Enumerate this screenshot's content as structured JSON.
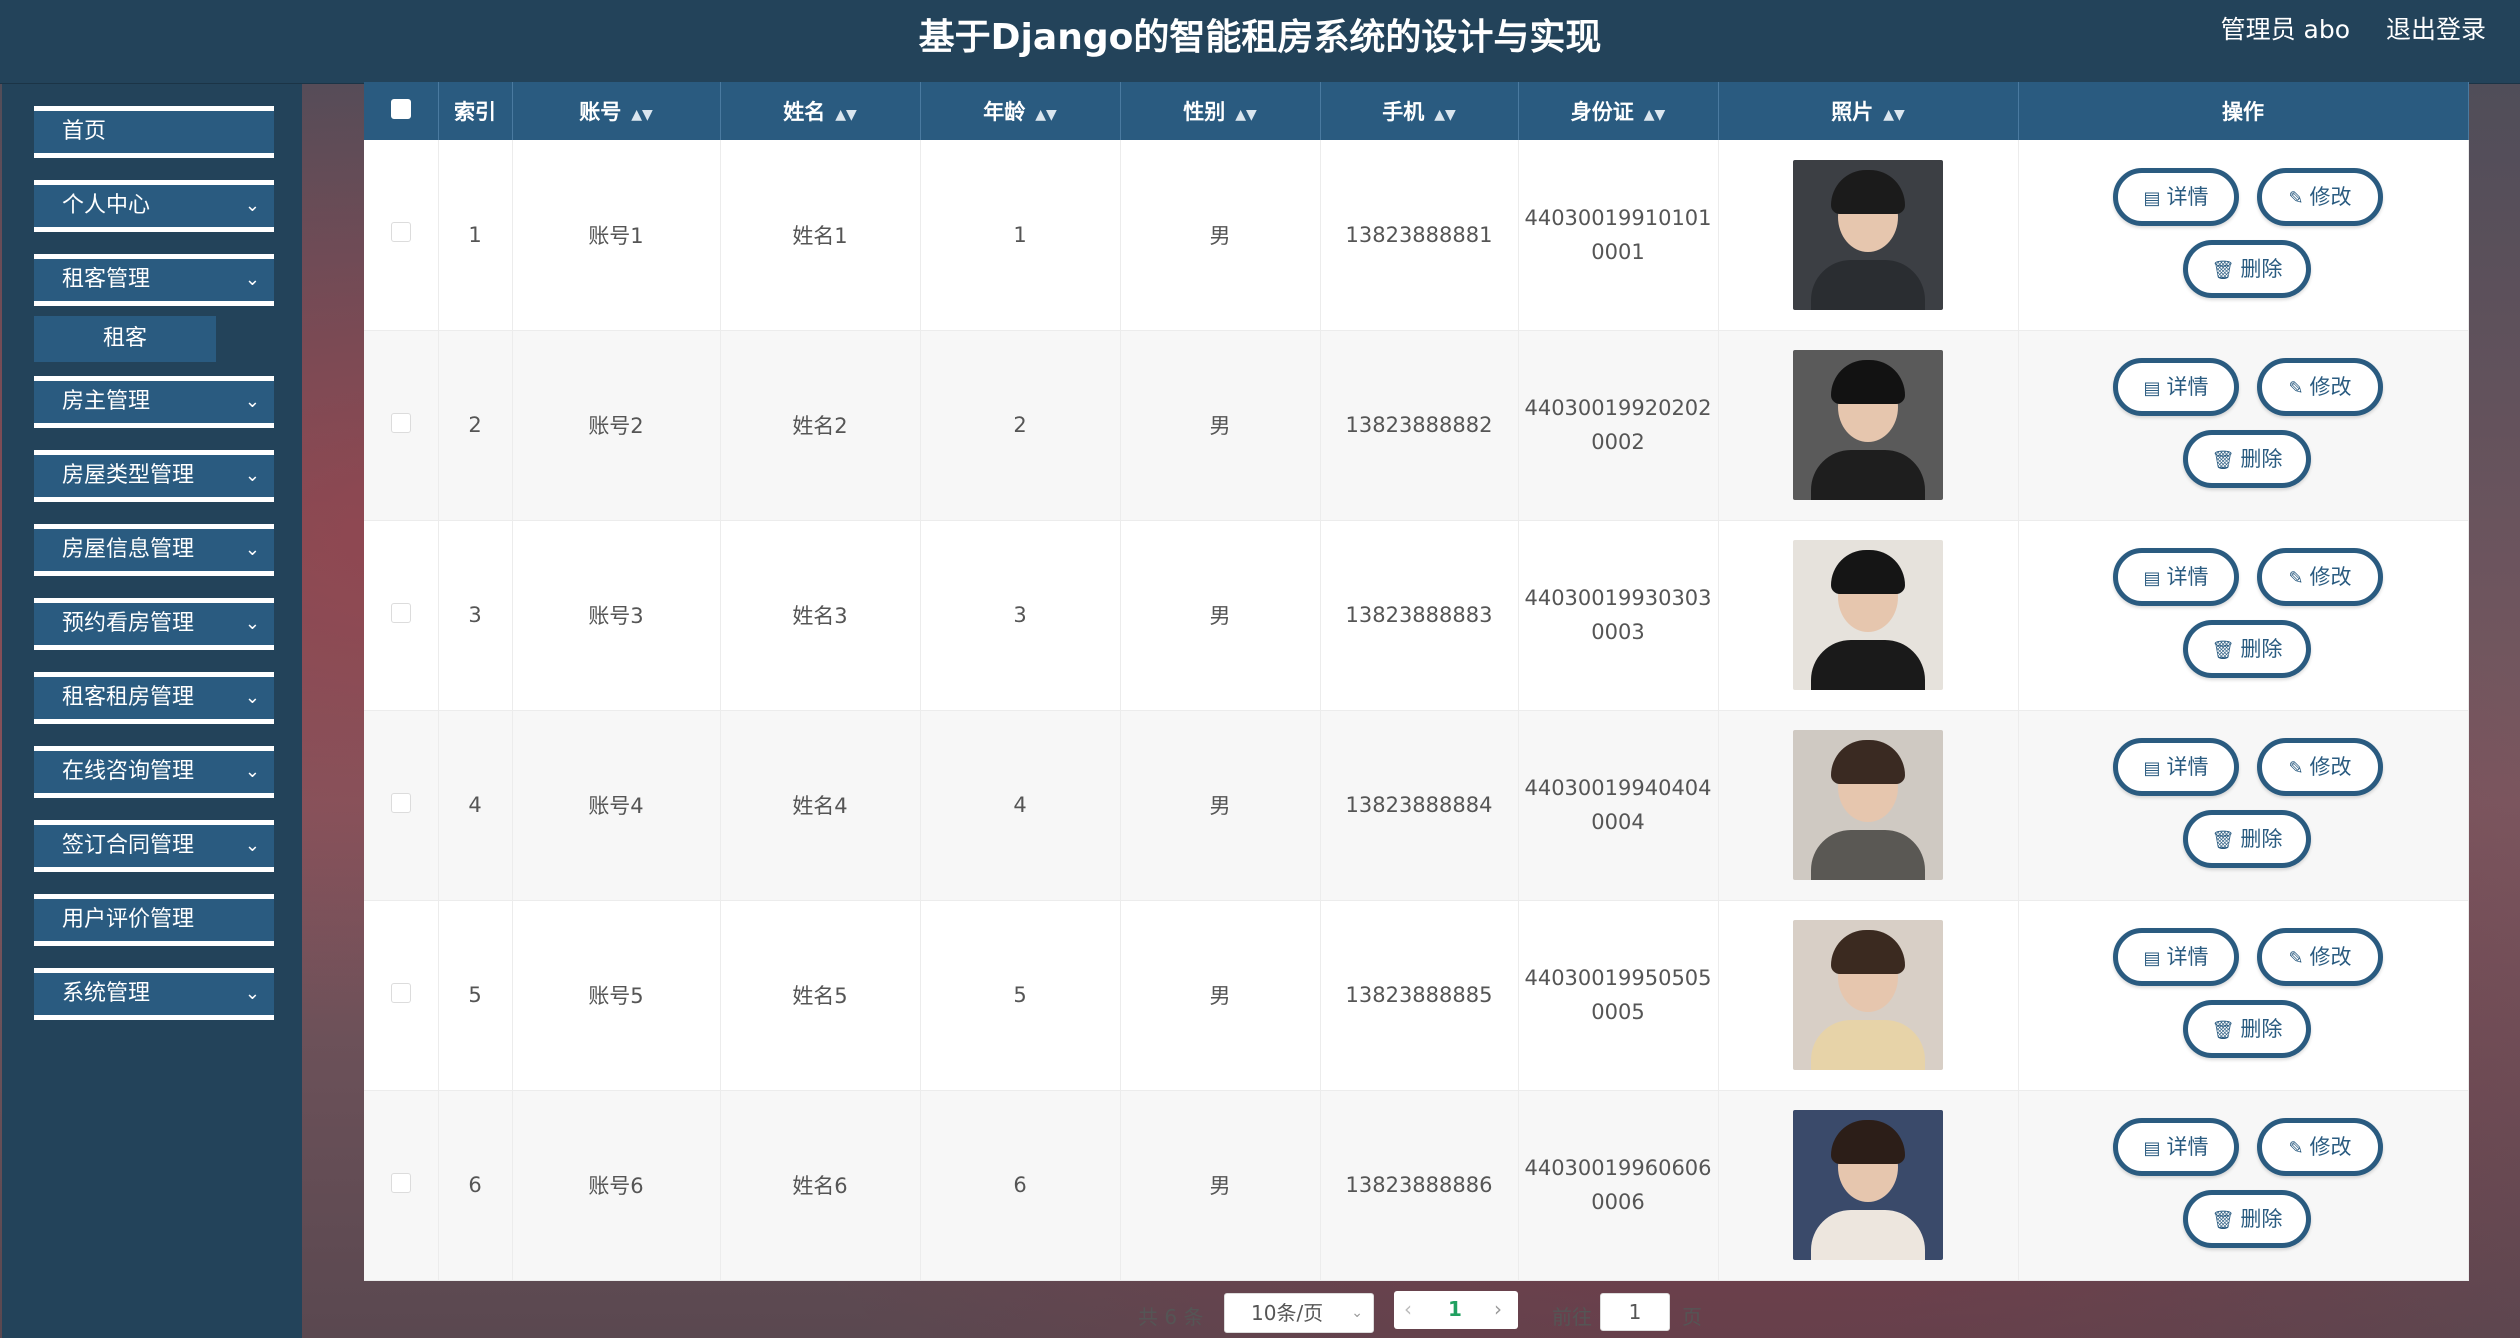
{
  "header": {
    "title": "基于Django的智能租房系统的设计与实现",
    "admin": "管理员 abo",
    "logout": "退出登录"
  },
  "sidebar": {
    "items": [
      {
        "label": "首页",
        "has_arrow": false
      },
      {
        "label": "个人中心",
        "has_arrow": true
      },
      {
        "label": "租客管理",
        "has_arrow": true
      },
      {
        "label": "房主管理",
        "has_arrow": true
      },
      {
        "label": "房屋类型管理",
        "has_arrow": true
      },
      {
        "label": "房屋信息管理",
        "has_arrow": true
      },
      {
        "label": "预约看房管理",
        "has_arrow": true
      },
      {
        "label": "租客租房管理",
        "has_arrow": true
      },
      {
        "label": "在线咨询管理",
        "has_arrow": true
      },
      {
        "label": "签订合同管理",
        "has_arrow": true
      },
      {
        "label": "用户评价管理",
        "has_arrow": false
      },
      {
        "label": "系统管理",
        "has_arrow": true
      }
    ],
    "sub_item": "租客"
  },
  "table": {
    "columns": [
      "索引",
      "账号",
      "姓名",
      "年龄",
      "性别",
      "手机",
      "身份证",
      "照片",
      "操作"
    ],
    "rows": [
      {
        "index": "1",
        "account": "账号1",
        "name": "姓名1",
        "age": "1",
        "gender": "男",
        "phone": "13823888881",
        "id_line1": "44030019910101",
        "id_line2": "0001"
      },
      {
        "index": "2",
        "account": "账号2",
        "name": "姓名2",
        "age": "2",
        "gender": "男",
        "phone": "13823888882",
        "id_line1": "44030019920202",
        "id_line2": "0002"
      },
      {
        "index": "3",
        "account": "账号3",
        "name": "姓名3",
        "age": "3",
        "gender": "男",
        "phone": "13823888883",
        "id_line1": "44030019930303",
        "id_line2": "0003"
      },
      {
        "index": "4",
        "account": "账号4",
        "name": "姓名4",
        "age": "4",
        "gender": "男",
        "phone": "13823888884",
        "id_line1": "44030019940404",
        "id_line2": "0004"
      },
      {
        "index": "5",
        "account": "账号5",
        "name": "姓名5",
        "age": "5",
        "gender": "男",
        "phone": "13823888885",
        "id_line1": "44030019950505",
        "id_line2": "0005"
      },
      {
        "index": "6",
        "account": "账号6",
        "name": "姓名6",
        "age": "6",
        "gender": "男",
        "phone": "13823888886",
        "id_line1": "44030019960606",
        "id_line2": "0006"
      }
    ],
    "actions": {
      "detail": "详情",
      "edit": "修改",
      "delete": "删除"
    }
  },
  "pagination": {
    "total": "共 6 条",
    "page_size": "10条/页",
    "current_page": "1",
    "goto_label": "前往",
    "goto_value": "1",
    "page_suffix": "页"
  },
  "colors": {
    "header": "#23435a",
    "accent": "#2a5b80"
  }
}
